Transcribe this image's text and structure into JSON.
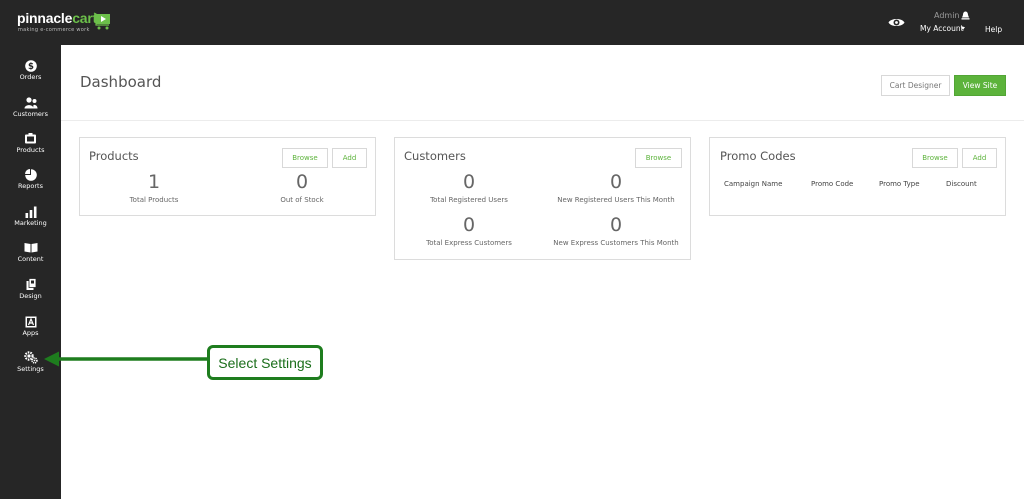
{
  "brand": {
    "name_part1": "pinnacle",
    "name_part2": "cart",
    "tagline": "making e-commerce work"
  },
  "topbar": {
    "admin_label": "Admin",
    "account_label": "My Account",
    "help_label": "Help"
  },
  "sidebar": {
    "items": [
      {
        "label": "Orders",
        "icon": "dollar-icon"
      },
      {
        "label": "Customers",
        "icon": "users-icon"
      },
      {
        "label": "Products",
        "icon": "products-icon"
      },
      {
        "label": "Reports",
        "icon": "pie-chart-icon"
      },
      {
        "label": "Marketing",
        "icon": "bar-chart-icon"
      },
      {
        "label": "Content",
        "icon": "book-icon"
      },
      {
        "label": "Design",
        "icon": "design-icon"
      },
      {
        "label": "Apps",
        "icon": "apps-icon"
      },
      {
        "label": "Settings",
        "icon": "gears-icon"
      }
    ]
  },
  "header": {
    "title": "Dashboard",
    "cart_designer_label": "Cart Designer",
    "view_site_label": "View Site"
  },
  "products_card": {
    "title": "Products",
    "browse_label": "Browse",
    "add_label": "Add",
    "stats": [
      {
        "value": "1",
        "label": "Total Products"
      },
      {
        "value": "0",
        "label": "Out of Stock"
      }
    ]
  },
  "customers_card": {
    "title": "Customers",
    "browse_label": "Browse",
    "stats": [
      {
        "value": "0",
        "label": "Total Registered Users"
      },
      {
        "value": "0",
        "label": "New Registered Users This Month"
      },
      {
        "value": "0",
        "label": "Total Express Customers"
      },
      {
        "value": "0",
        "label": "New Express Customers This Month"
      }
    ]
  },
  "promo_card": {
    "title": "Promo Codes",
    "browse_label": "Browse",
    "add_label": "Add",
    "columns": [
      "Campaign Name",
      "Promo Code",
      "Promo Type",
      "Discount"
    ]
  },
  "annotation": {
    "text": "Select Settings"
  },
  "colors": {
    "sidebar_bg": "#262626",
    "accent_green": "#5cb33b",
    "annotation_green": "#1e7d1e"
  }
}
